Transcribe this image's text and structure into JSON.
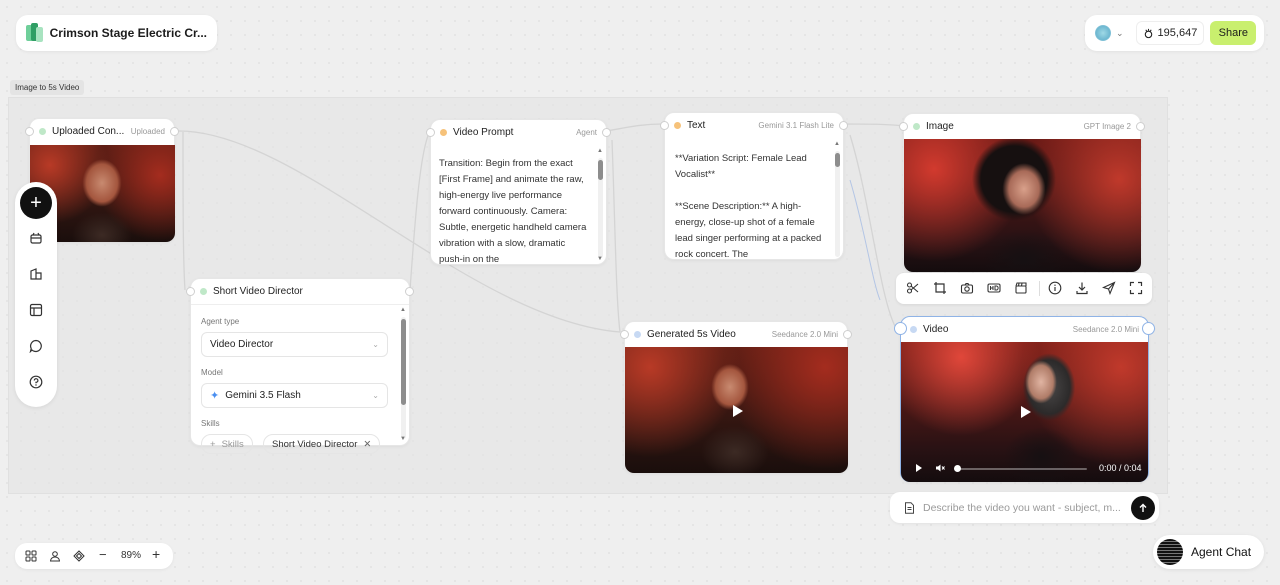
{
  "header": {
    "project_title": "Crimson Stage Electric Cr...",
    "credits": "195,647",
    "share_label": "Share"
  },
  "canvas": {
    "group_label": "Image to 5s Video"
  },
  "nodes": {
    "uploaded": {
      "title": "Uploaded Con...",
      "tag": "Uploaded"
    },
    "video_prompt": {
      "title": "Video Prompt",
      "tag": "Agent",
      "body": "Transition: Begin from the exact [First Frame] and animate the raw, high-energy live performance forward continuously. Camera: Subtle, energetic handheld camera vibration with a slow, dramatic push-in on the"
    },
    "text": {
      "title": "Text",
      "tag": "Gemini 3.1 Flash Lite",
      "body": "**Variation Script: Female Lead Vocalist**\n\n**Scene Description:** A high-energy, close-up shot of a female lead singer performing at a packed rock concert. The"
    },
    "image": {
      "title": "Image",
      "tag": "GPT Image 2"
    },
    "director": {
      "title": "Short Video Director",
      "agent_type_label": "Agent type",
      "agent_type_value": "Video Director",
      "model_label": "Model",
      "model_value": "Gemini 3.5 Flash",
      "skills_label": "Skills",
      "skills_add": "Skills",
      "skill_chip": "Short Video Director"
    },
    "generated": {
      "title": "Generated 5s Video",
      "tag": "Seedance 2.0 Mini"
    },
    "video": {
      "title": "Video",
      "tag": "Seedance 2.0 Mini",
      "time": "0:00 / 0:04"
    }
  },
  "prompt": {
    "placeholder": "Describe the video you want - subject, m..."
  },
  "zoom": "89%",
  "agent_chat_label": "Agent Chat",
  "colors": {
    "share_bg": "#c9ef6e",
    "dot_green": "#bfe8c8",
    "dot_orange": "#f6c27a",
    "dot_blue": "#c7d9f3"
  }
}
